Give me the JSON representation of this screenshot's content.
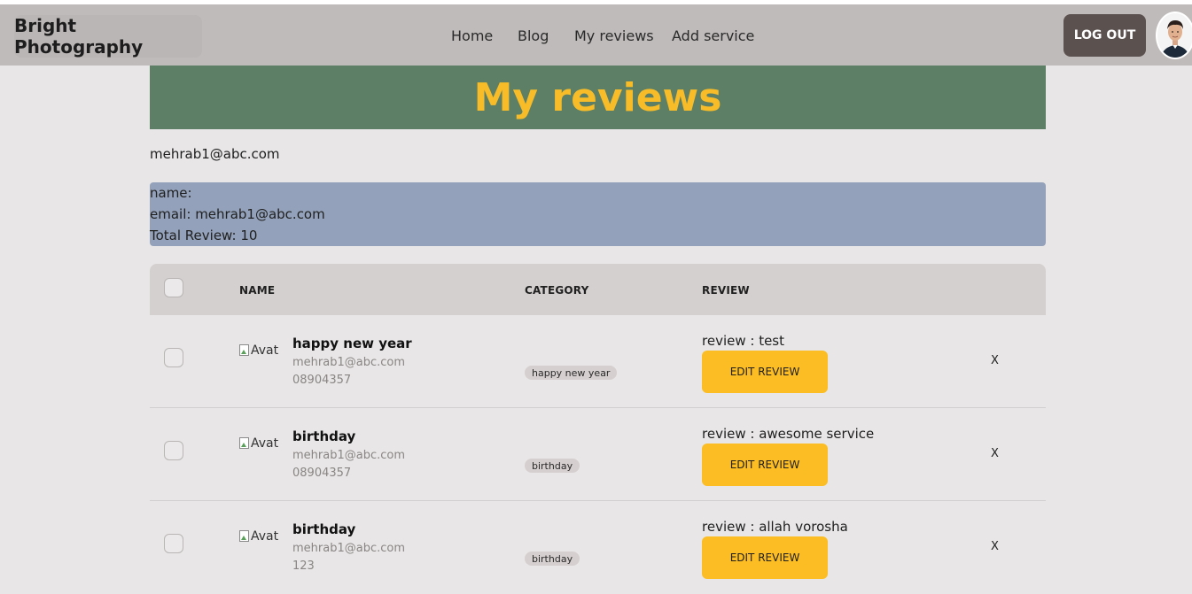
{
  "navbar": {
    "brand": "Bright Photography",
    "links": [
      "Home",
      "Blog",
      "My reviews",
      "Add service"
    ],
    "logout_label": "LOG OUT"
  },
  "page": {
    "title": "My reviews",
    "user_email": "mehrab1@abc.com"
  },
  "info": {
    "name_line": "name:",
    "email_line": "email: mehrab1@abc.com",
    "total_line": "Total Review: 10"
  },
  "table": {
    "headers": [
      "NAME",
      "CATEGORY",
      "REVIEW"
    ],
    "rows": [
      {
        "img_alt": "Avat",
        "name": "happy new year",
        "email": "mehrab1@abc.com",
        "phone": "08904357",
        "category": "happy new year",
        "review": "review : test",
        "edit_label": "EDIT REVIEW",
        "delete_label": "X"
      },
      {
        "img_alt": "Avat",
        "name": "birthday",
        "email": "mehrab1@abc.com",
        "phone": "08904357",
        "category": "birthday",
        "review": "review : awesome service",
        "edit_label": "EDIT REVIEW",
        "delete_label": "X"
      },
      {
        "img_alt": "Avat",
        "name": "birthday",
        "email": "mehrab1@abc.com",
        "phone": "123",
        "category": "birthday",
        "review": "review : allah vorosha",
        "edit_label": "EDIT REVIEW",
        "delete_label": "X"
      }
    ]
  },
  "colors": {
    "navbar_bg": "#bfbbba",
    "title_bg": "#5c7f66",
    "title_text": "#f7bc27",
    "info_bg": "#93a2ba",
    "edit_button": "#fbbd23",
    "logout_bg": "#5b514f"
  }
}
